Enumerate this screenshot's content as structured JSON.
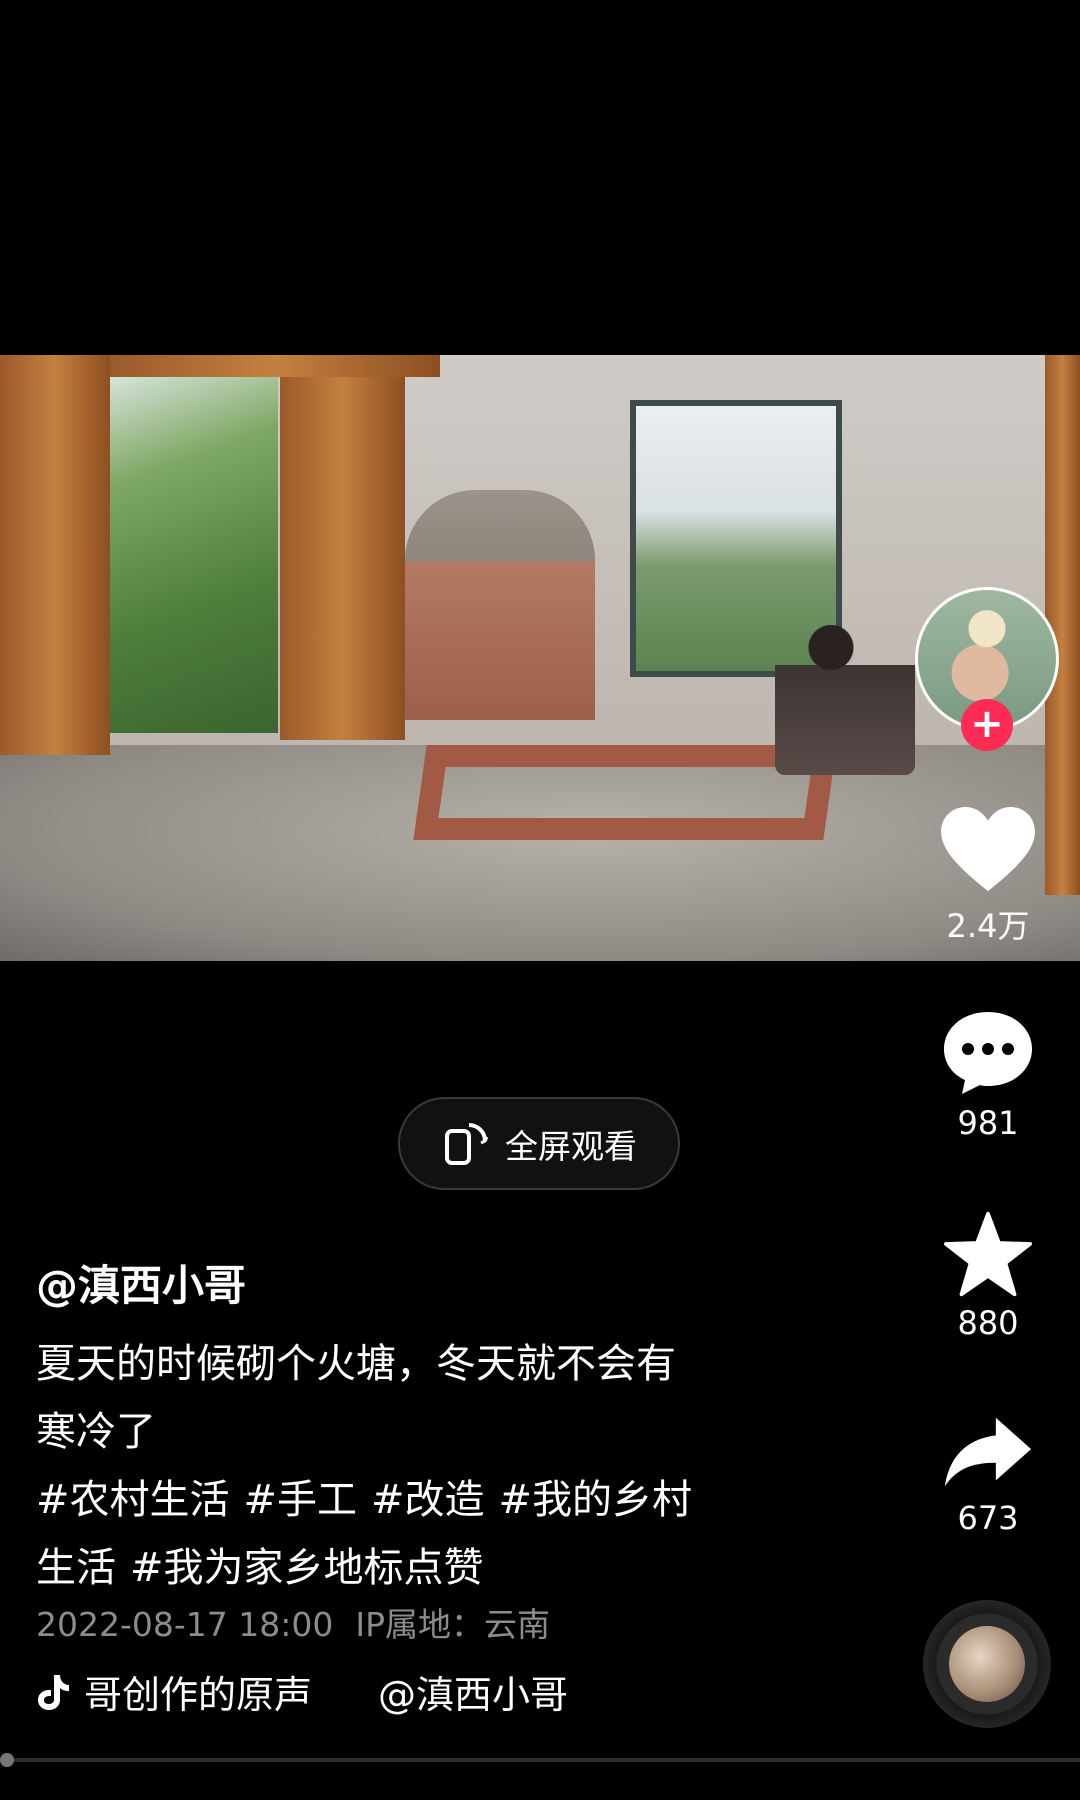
{
  "player": {
    "fullscreen_label": "全屏观看"
  },
  "sidebar": {
    "likes": "2.4万",
    "comments": "981",
    "favorites": "880",
    "shares": "673"
  },
  "post": {
    "author": "@滇西小哥",
    "caption_line1": "夏天的时候砌个火塘，冬天就不会有",
    "caption_line2": "寒冷了",
    "tags": [
      "#农村生活",
      "#手工",
      "#改造",
      "#我的乡村",
      "生活",
      "#我为家乡地标点赞"
    ],
    "date": "2022-08-17 18:00",
    "ip_location": "IP属地：云南",
    "music_title": "哥创作的原声",
    "music_author": "@滇西小哥"
  },
  "colors": {
    "follow_accent": "#fe2c55",
    "meta_text": "#8c8c8c"
  },
  "icons": {
    "follow": "plus-icon",
    "like": "heart-icon",
    "comment": "comment-bubble-icon",
    "favorite": "star-icon",
    "share": "share-arrow-icon",
    "music": "tiktok-note-icon",
    "fullscreen": "rotate-phone-icon"
  }
}
